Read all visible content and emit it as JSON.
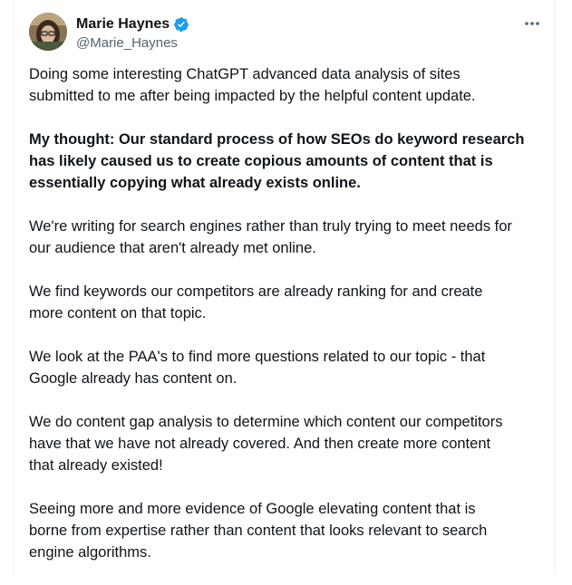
{
  "author": {
    "name": "Marie Haynes",
    "handle": "@Marie_Haynes",
    "verified": true,
    "avatar_icon": "profile-photo",
    "verified_icon": "verified-badge-icon",
    "verified_color": "#1d9bf0"
  },
  "more_icon": "more-options-icon",
  "paragraphs": [
    {
      "text": "Doing some interesting ChatGPT advanced data analysis of sites\nsubmitted to me after being impacted by the helpful content update.",
      "bold": false
    },
    {
      "text": "My thought: Our standard process of how SEOs do keyword research\nhas likely caused us to create copious amounts of content that is\nessentially copying what already exists online.",
      "bold": true
    },
    {
      "text": "We're writing for search engines rather than truly trying to meet needs for\nour audience that aren't already met online.",
      "bold": false
    },
    {
      "text": "We find keywords our competitors are already ranking for and create\nmore content on that topic.",
      "bold": false
    },
    {
      "text": "We look at the PAA's to find more questions related to our topic - that\nGoogle already has content on.",
      "bold": false
    },
    {
      "text": "We do content gap analysis to determine which content our competitors\nhave that we have not already covered. And then create more content\nthat already existed!",
      "bold": false
    },
    {
      "text": "Seeing more and more evidence of Google elevating content that is\nborne from expertise rather than content that looks relevant to search\nengine algorithms.",
      "bold": false
    }
  ]
}
